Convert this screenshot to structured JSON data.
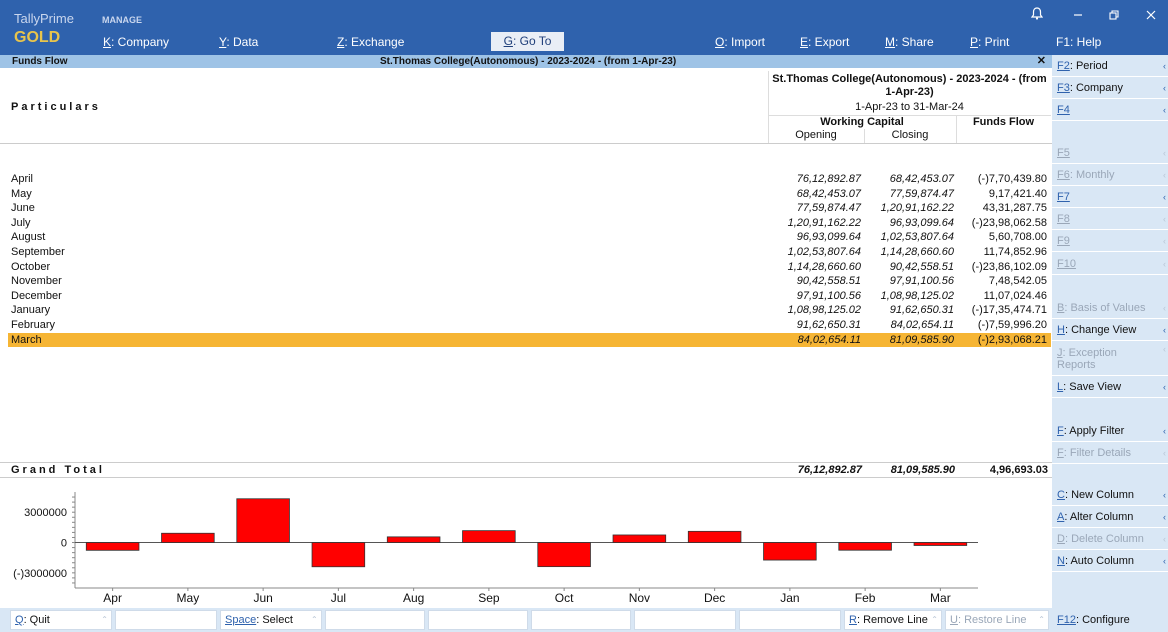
{
  "app": {
    "brand_top": "TallyPrime",
    "brand_edition": "GOLD",
    "manage_label": "MANAGE"
  },
  "menu": [
    {
      "key": "K",
      "label": ": Company"
    },
    {
      "key": "Y",
      "label": ": Data"
    },
    {
      "key": "Z",
      "label": ": Exchange"
    },
    {
      "key": "G",
      "label": ": Go To"
    },
    {
      "key": "O",
      "label": ": Import"
    },
    {
      "key": "E",
      "label": ": Export"
    },
    {
      "key": "M",
      "label": ": Share"
    },
    {
      "key": "P",
      "label": ": Print"
    }
  ],
  "help_label": "F1: Help",
  "report": {
    "name": "Funds Flow",
    "strip_title": "St.Thomas College(Autonomous) - 2023-2024 - (from 1-Apr-23)",
    "particulars_label": "Particulars",
    "company_header": "St.Thomas College(Autonomous) - 2023-2024 - (from 1-Apr-23)",
    "range": "1-Apr-23 to 31-Mar-24",
    "wc_label": "Working Capital",
    "funds_label": "Funds Flow",
    "opening_label": "Opening",
    "closing_label": "Closing"
  },
  "rows": [
    {
      "month": "April",
      "opening": "76,12,892.87",
      "closing": "68,42,453.07",
      "funds": "(-)7,70,439.80"
    },
    {
      "month": "May",
      "opening": "68,42,453.07",
      "closing": "77,59,874.47",
      "funds": "9,17,421.40"
    },
    {
      "month": "June",
      "opening": "77,59,874.47",
      "closing": "1,20,91,162.22",
      "funds": "43,31,287.75"
    },
    {
      "month": "July",
      "opening": "1,20,91,162.22",
      "closing": "96,93,099.64",
      "funds": "(-)23,98,062.58"
    },
    {
      "month": "August",
      "opening": "96,93,099.64",
      "closing": "1,02,53,807.64",
      "funds": "5,60,708.00"
    },
    {
      "month": "September",
      "opening": "1,02,53,807.64",
      "closing": "1,14,28,660.60",
      "funds": "11,74,852.96"
    },
    {
      "month": "October",
      "opening": "1,14,28,660.60",
      "closing": "90,42,558.51",
      "funds": "(-)23,86,102.09"
    },
    {
      "month": "November",
      "opening": "90,42,558.51",
      "closing": "97,91,100.56",
      "funds": "7,48,542.05"
    },
    {
      "month": "December",
      "opening": "97,91,100.56",
      "closing": "1,08,98,125.02",
      "funds": "11,07,024.46"
    },
    {
      "month": "January",
      "opening": "1,08,98,125.02",
      "closing": "91,62,650.31",
      "funds": "(-)17,35,474.71"
    },
    {
      "month": "February",
      "opening": "91,62,650.31",
      "closing": "84,02,654.11",
      "funds": "(-)7,59,996.20"
    },
    {
      "month": "March",
      "opening": "84,02,654.11",
      "closing": "81,09,585.90",
      "funds": "(-)2,93,068.21"
    }
  ],
  "selected_row": 11,
  "grand_total": {
    "label": "Grand Total",
    "opening": "76,12,892.87",
    "closing": "81,09,585.90",
    "funds": "4,96,693.03"
  },
  "right_buttons": [
    {
      "key": "F2",
      "label": ": Period"
    },
    {
      "key": "F3",
      "label": ": Company"
    },
    {
      "key": "F4",
      "label": ""
    },
    {
      "key": "F5",
      "label": ""
    },
    {
      "key": "F6",
      "label": ": Monthly"
    },
    {
      "key": "F7",
      "label": ""
    },
    {
      "key": "F8",
      "label": ""
    },
    {
      "key": "F9",
      "label": ""
    },
    {
      "key": "F10",
      "label": ""
    },
    {
      "key": "B",
      "label": ": Basis of Values"
    },
    {
      "key": "H",
      "label": ": Change View"
    },
    {
      "key": "J",
      "label": ": Exception Reports"
    },
    {
      "key": "L",
      "label": ": Save View"
    },
    {
      "key": "F",
      "label": ": Apply Filter"
    },
    {
      "key": "F",
      "label": ": Filter Details"
    },
    {
      "key": "C",
      "label": ": New Column"
    },
    {
      "key": "A",
      "label": ": Alter Column"
    },
    {
      "key": "D",
      "label": ": Delete Column"
    },
    {
      "key": "N",
      "label": ": Auto Column"
    }
  ],
  "bottom_buttons": [
    {
      "key": "Q",
      "label": ": Quit"
    },
    {
      "key": "Space",
      "label": ": Select"
    },
    {
      "key": "R",
      "label": ": Remove Line"
    },
    {
      "key": "U",
      "label": ": Restore Line"
    }
  ],
  "configure": {
    "key": "F12",
    "label": ": Configure"
  },
  "colors": {
    "topbar": "#2f62ad",
    "brand_gold": "#e8c44c",
    "selection": "#f6b534",
    "bar": "#ff0000",
    "panel": "#d9e7f5"
  },
  "chart_data": {
    "type": "bar",
    "categories": [
      "Apr",
      "May",
      "Jun",
      "Jul",
      "Aug",
      "Sep",
      "Oct",
      "Nov",
      "Dec",
      "Jan",
      "Feb",
      "Mar"
    ],
    "values": [
      -770439.8,
      917421.4,
      4331287.75,
      -2398062.58,
      560708.0,
      1174852.96,
      -2386102.09,
      748542.05,
      1107024.46,
      -1735474.71,
      -759996.2,
      -293068.21
    ],
    "yticks": [
      "3000000",
      "0",
      "(-)3000000"
    ],
    "ytick_values": [
      3000000,
      0,
      -3000000
    ],
    "ylim": [
      -4500000,
      5000000
    ]
  }
}
